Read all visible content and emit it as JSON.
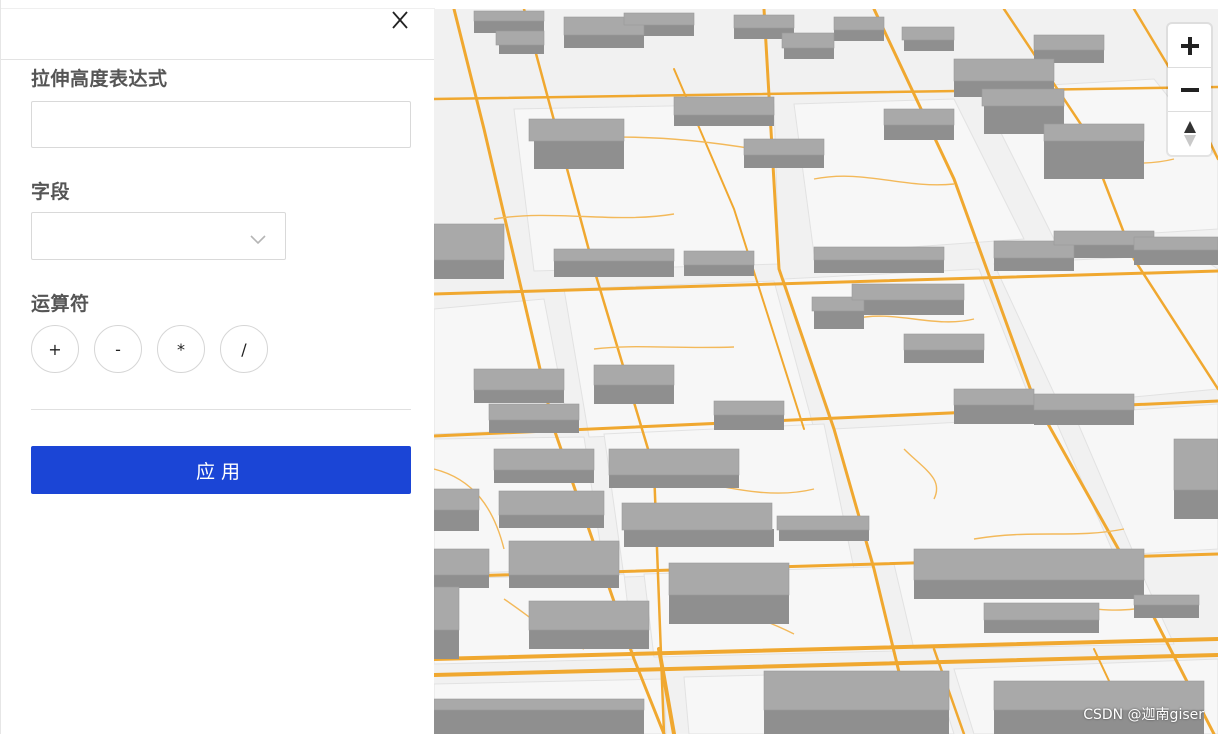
{
  "panel": {
    "extrude_expression_label": "拉伸高度表达式",
    "extrude_expression_value": "",
    "field_label": "字段",
    "field_selected": "",
    "operator_label": "运算符",
    "operators": [
      "+",
      "-",
      "*",
      "/"
    ],
    "apply_label": "应用"
  },
  "map_controls": {
    "zoom_in": "+",
    "zoom_out": "−",
    "compass": "▲▼"
  },
  "watermark": "CSDN @迦南giser",
  "colors": {
    "accent": "#1b45d6",
    "road": "#f0a830",
    "building": "#a9a9a9",
    "ground": "#f1f1f1"
  }
}
